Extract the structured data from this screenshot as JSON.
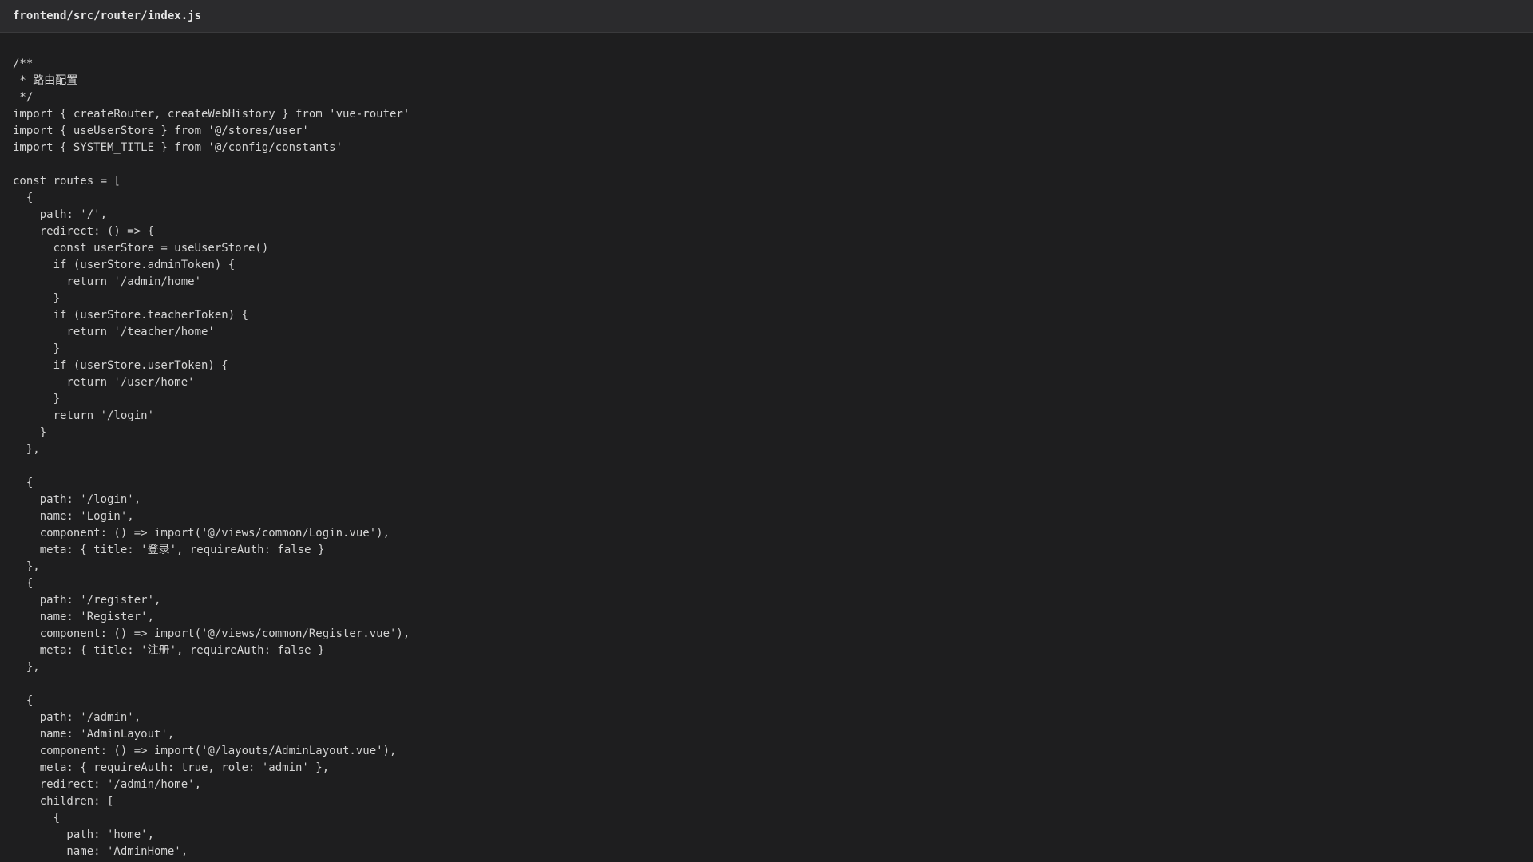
{
  "file": {
    "path": "frontend/src/router/index.js"
  },
  "code": {
    "lines": [
      "/**",
      " * 路由配置",
      " */",
      "import { createRouter, createWebHistory } from 'vue-router'",
      "import { useUserStore } from '@/stores/user'",
      "import { SYSTEM_TITLE } from '@/config/constants'",
      "",
      "const routes = [",
      "  {",
      "    path: '/',",
      "    redirect: () => {",
      "      const userStore = useUserStore()",
      "      if (userStore.adminToken) {",
      "        return '/admin/home'",
      "      }",
      "      if (userStore.teacherToken) {",
      "        return '/teacher/home'",
      "      }",
      "      if (userStore.userToken) {",
      "        return '/user/home'",
      "      }",
      "      return '/login'",
      "    }",
      "  },",
      "",
      "  {",
      "    path: '/login',",
      "    name: 'Login',",
      "    component: () => import('@/views/common/Login.vue'),",
      "    meta: { title: '登录', requireAuth: false }",
      "  },",
      "  {",
      "    path: '/register',",
      "    name: 'Register',",
      "    component: () => import('@/views/common/Register.vue'),",
      "    meta: { title: '注册', requireAuth: false }",
      "  },",
      "",
      "  {",
      "    path: '/admin',",
      "    name: 'AdminLayout',",
      "    component: () => import('@/layouts/AdminLayout.vue'),",
      "    meta: { requireAuth: true, role: 'admin' },",
      "    redirect: '/admin/home',",
      "    children: [",
      "      {",
      "        path: 'home',",
      "        name: 'AdminHome',"
    ]
  }
}
